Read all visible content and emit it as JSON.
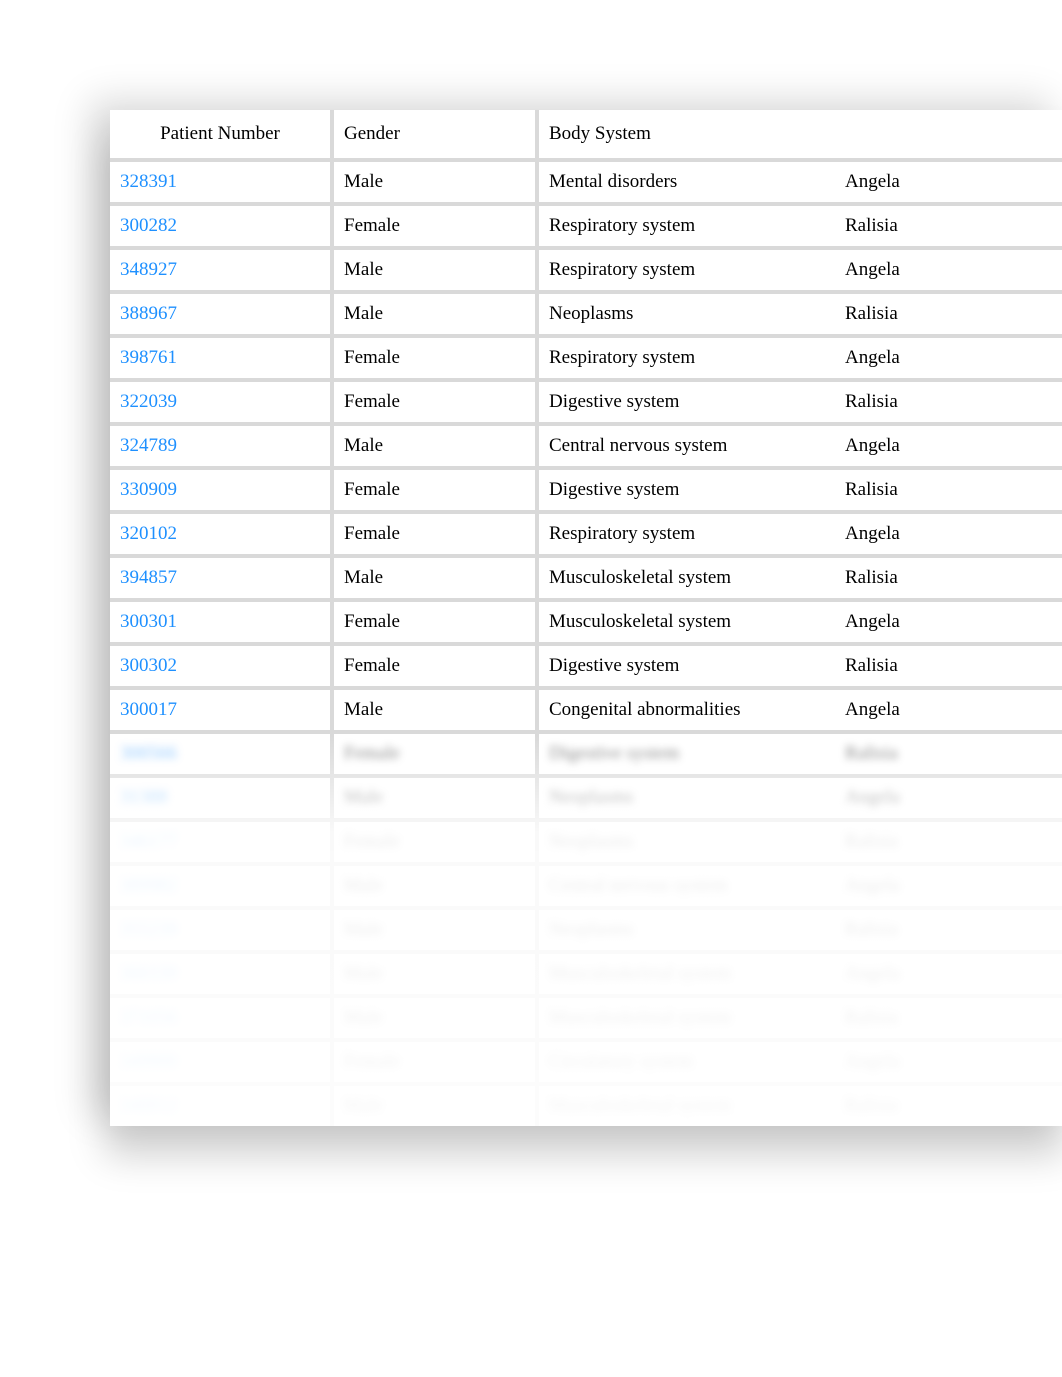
{
  "headers": {
    "patient": "Patient Number",
    "gender": "Gender",
    "body": "Body System",
    "assignee": ""
  },
  "rows": [
    {
      "patient": "328391",
      "gender": "Male",
      "body": "Mental disorders",
      "assignee": "Angela",
      "blurred": false
    },
    {
      "patient": "300282",
      "gender": "Female",
      "body": "Respiratory system",
      "assignee": "Ralisia",
      "blurred": false
    },
    {
      "patient": "348927",
      "gender": "Male",
      "body": "Respiratory system",
      "assignee": "Angela",
      "blurred": false
    },
    {
      "patient": "388967",
      "gender": "Male",
      "body": "Neoplasms",
      "assignee": "Ralisia",
      "blurred": false
    },
    {
      "patient": "398761",
      "gender": "Female",
      "body": "Respiratory system",
      "assignee": "Angela",
      "blurred": false
    },
    {
      "patient": "322039",
      "gender": "Female",
      "body": "Digestive system",
      "assignee": "Ralisia",
      "blurred": false
    },
    {
      "patient": "324789",
      "gender": "Male",
      "body": "Central nervous system",
      "assignee": "Angela",
      "blurred": false
    },
    {
      "patient": "330909",
      "gender": "Female",
      "body": "Digestive system",
      "assignee": "Ralisia",
      "blurred": false
    },
    {
      "patient": "320102",
      "gender": "Female",
      "body": "Respiratory system",
      "assignee": "Angela",
      "blurred": false
    },
    {
      "patient": "394857",
      "gender": "Male",
      "body": "Musculoskeletal system",
      "assignee": "Ralisia",
      "blurred": false
    },
    {
      "patient": "300301",
      "gender": "Female",
      "body": "Musculoskeletal system",
      "assignee": "Angela",
      "blurred": false
    },
    {
      "patient": "300302",
      "gender": "Female",
      "body": "Digestive system",
      "assignee": "Ralisia",
      "blurred": false
    },
    {
      "patient": "300017",
      "gender": "Male",
      "body": "Congenital abnormalities",
      "assignee": "Angela",
      "blurred": false
    },
    {
      "patient": "300566",
      "gender": "Female",
      "body": "Digestive system",
      "assignee": "Ralisia",
      "blurred": true
    },
    {
      "patient": "31388",
      "gender": "Male",
      "body": "Neoplasms",
      "assignee": "Angela",
      "blurred": true
    },
    {
      "patient": "346177",
      "gender": "Female",
      "body": "Neoplasms",
      "assignee": "Ralisia",
      "blurred": true
    },
    {
      "patient": "389982",
      "gender": "Male",
      "body": "Central nervous system",
      "assignee": "Angela",
      "blurred": true
    },
    {
      "patient": "355239",
      "gender": "Male",
      "body": "Neoplasms",
      "assignee": "Ralisia",
      "blurred": true
    },
    {
      "patient": "360339",
      "gender": "Male",
      "body": "Musculoskeletal system",
      "assignee": "Angela",
      "blurred": true
    },
    {
      "patient": "371056",
      "gender": "Male",
      "body": "Musculoskeletal system",
      "assignee": "Ralisia",
      "blurred": true
    },
    {
      "patient": "349900",
      "gender": "Female",
      "body": "Circulatory system",
      "assignee": "Angela",
      "blurred": true
    },
    {
      "patient": "348812",
      "gender": "Male",
      "body": "Musculoskeletal system",
      "assignee": "Ralisia",
      "blurred": true
    }
  ]
}
